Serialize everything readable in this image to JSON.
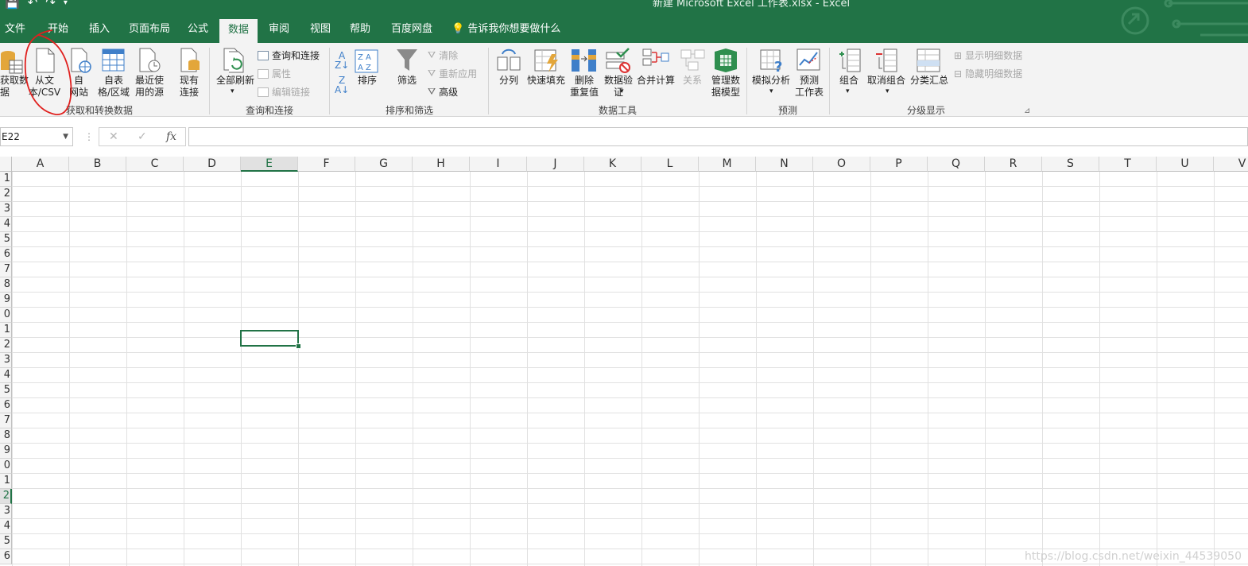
{
  "window": {
    "title": "新建 Microsoft Excel 工作表.xlsx  -  Excel"
  },
  "tabs": [
    "文件",
    "开始",
    "插入",
    "页面布局",
    "公式",
    "数据",
    "审阅",
    "视图",
    "帮助",
    "百度网盘"
  ],
  "tell_me": "告诉我你想要做什么",
  "ribbon": {
    "get_data": "获取数\n据",
    "from_text": "从文\n本/CSV",
    "from_web": "自\n网站",
    "from_table": "自表\n格/区域",
    "recent_sources": "最近使\n用的源",
    "existing_connections": "现有\n连接",
    "refresh_all": "全部刷新",
    "queries_connections": "查询和连接",
    "properties": "属性",
    "edit_links": "编辑链接",
    "sort": "排序",
    "filter": "筛选",
    "clear": "清除",
    "reapply": "重新应用",
    "advanced": "高级",
    "text_to_columns": "分列",
    "flash_fill": "快速填充",
    "remove_duplicates": "删除\n重复值",
    "data_validation": "数据验\n证",
    "consolidate": "合并计算",
    "relationships": "关系",
    "manage_data_model": "管理数\n据模型",
    "what_if": "模拟分析",
    "forecast_sheet": "预测\n工作表",
    "group": "组合",
    "ungroup": "取消组合",
    "subtotal": "分类汇总",
    "show_detail": "显示明细数据",
    "hide_detail": "隐藏明细数据",
    "groups": {
      "get_transform": "获取和转换数据",
      "queries": "查询和连接",
      "sort_filter": "排序和筛选",
      "data_tools": "数据工具",
      "forecast": "预测",
      "outline": "分级显示"
    }
  },
  "formula_bar": {
    "name_box": "E22",
    "cancel": "✕",
    "enter": "✓",
    "fx": "fx",
    "value": ""
  },
  "sheet": {
    "columns": [
      "A",
      "B",
      "C",
      "D",
      "E",
      "F",
      "G",
      "H",
      "I",
      "J",
      "K",
      "L",
      "M",
      "N",
      "O",
      "P",
      "Q",
      "R",
      "S",
      "T",
      "U",
      "V"
    ],
    "rows": [
      "1",
      "2",
      "3",
      "4",
      "5",
      "6",
      "7",
      "8",
      "9",
      "0",
      "1",
      "2",
      "3",
      "4",
      "5",
      "6",
      "7",
      "8",
      "9",
      "0",
      "1",
      "2",
      "3",
      "4",
      "5",
      "6"
    ],
    "selected_column": "E",
    "selected_row_index": 21
  },
  "watermark": "https://blog.csdn.net/weixin_44539050",
  "colors": {
    "excel_green": "#217346",
    "annotation_red": "#e0201e"
  }
}
